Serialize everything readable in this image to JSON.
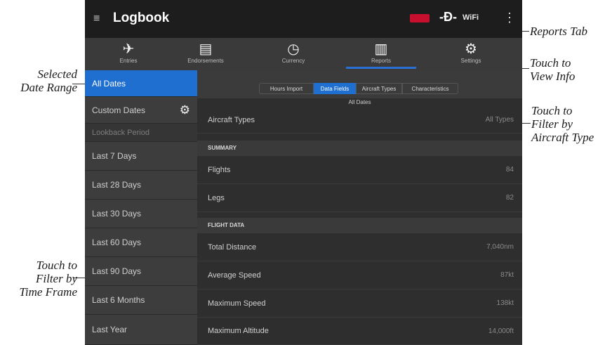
{
  "app": {
    "title": "Logbook",
    "menu_icon": "hamburger-menu-icon",
    "status_badge": "",
    "bluetooth_icon": "bluetooth-icon",
    "wifi_text": "WiFi",
    "more_icon": "more-vertical-icon"
  },
  "tabs": [
    {
      "label": "Entries",
      "icon": "airplane-icon"
    },
    {
      "label": "Endorsements",
      "icon": "document-icon"
    },
    {
      "label": "Currency",
      "icon": "clock-icon"
    },
    {
      "label": "Reports",
      "icon": "bar-chart-icon",
      "active": true
    },
    {
      "label": "Settings",
      "icon": "gear-icon"
    }
  ],
  "sidebar": {
    "all_dates": "All Dates",
    "custom_dates": "Custom Dates",
    "lookback_header": "Lookback Period",
    "items": [
      "Last 7 Days",
      "Last 28 Days",
      "Last 30 Days",
      "Last 60 Days",
      "Last 90 Days",
      "Last 6 Months",
      "Last Year"
    ]
  },
  "segments": [
    "Hours Import",
    "Data Fields",
    "Aircraft Types",
    "Characteristics"
  ],
  "active_segment": "Data Fields",
  "range_label": "All Dates",
  "filter_row": {
    "label": "Aircraft Types",
    "value": "All Types"
  },
  "summary": {
    "header": "SUMMARY",
    "rows": [
      {
        "label": "Flights",
        "value": "84"
      },
      {
        "label": "Legs",
        "value": "82"
      }
    ]
  },
  "flight_data": {
    "header": "FLIGHT DATA",
    "rows": [
      {
        "label": "Total Distance",
        "value": "7,040nm"
      },
      {
        "label": "Average Speed",
        "value": "87kt"
      },
      {
        "label": "Maximum Speed",
        "value": "138kt"
      },
      {
        "label": "Maximum Altitude",
        "value": "14,000ft"
      }
    ]
  },
  "callouts": {
    "reports_tab": "Reports Tab",
    "view_info_1": "Touch to",
    "view_info_2": "View Info",
    "filter_type_1": "Touch to",
    "filter_type_2": "Filter by",
    "filter_type_3": "Aircraft Type",
    "selected_range_1": "Selected",
    "selected_range_2": "Date Range",
    "filter_time_1": "Touch to",
    "filter_time_2": "Filter by",
    "filter_time_3": "Time Frame"
  },
  "colors": {
    "accent": "#1f6fd1",
    "panel": "#2e2e2e",
    "sidebar": "#3d3d3d",
    "badge": "#c8102e"
  }
}
